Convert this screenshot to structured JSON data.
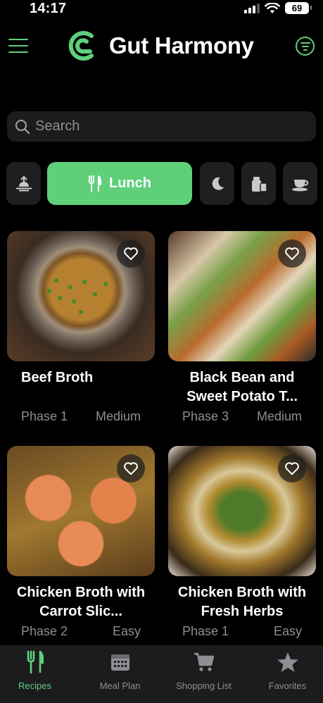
{
  "status_bar": {
    "time": "14:17",
    "battery": "69"
  },
  "header": {
    "title": "Gut Harmony"
  },
  "search": {
    "placeholder": "Search"
  },
  "meal_tabs": [
    {
      "icon": "sunrise-icon",
      "label": ""
    },
    {
      "icon": "fork-knife-icon",
      "label": "Lunch",
      "active": true
    },
    {
      "icon": "moon-icon",
      "label": ""
    },
    {
      "icon": "snack-icon",
      "label": ""
    },
    {
      "icon": "teacup-icon",
      "label": ""
    }
  ],
  "recipes": [
    {
      "name": "Beef Broth",
      "phase": "Phase 1",
      "difficulty": "Medium"
    },
    {
      "name": "Black Bean and Sweet Potato T...",
      "phase": "Phase 3",
      "difficulty": "Medium"
    },
    {
      "name": "Chicken Broth with Carrot Slic...",
      "phase": "Phase 2",
      "difficulty": "Easy"
    },
    {
      "name": "Chicken Broth with Fresh Herbs",
      "phase": "Phase 1",
      "difficulty": "Easy"
    }
  ],
  "bottom_nav": [
    {
      "label": "Recipes",
      "icon": "fork-knife-icon",
      "active": true
    },
    {
      "label": "Meal Plan",
      "icon": "calendar-icon"
    },
    {
      "label": "Shopping List",
      "icon": "cart-icon"
    },
    {
      "label": "Favorites",
      "icon": "star-icon"
    }
  ],
  "colors": {
    "accent": "#5fcf7a",
    "background": "#000000",
    "surface": "#1c1c1e",
    "muted": "#8e8e93"
  }
}
